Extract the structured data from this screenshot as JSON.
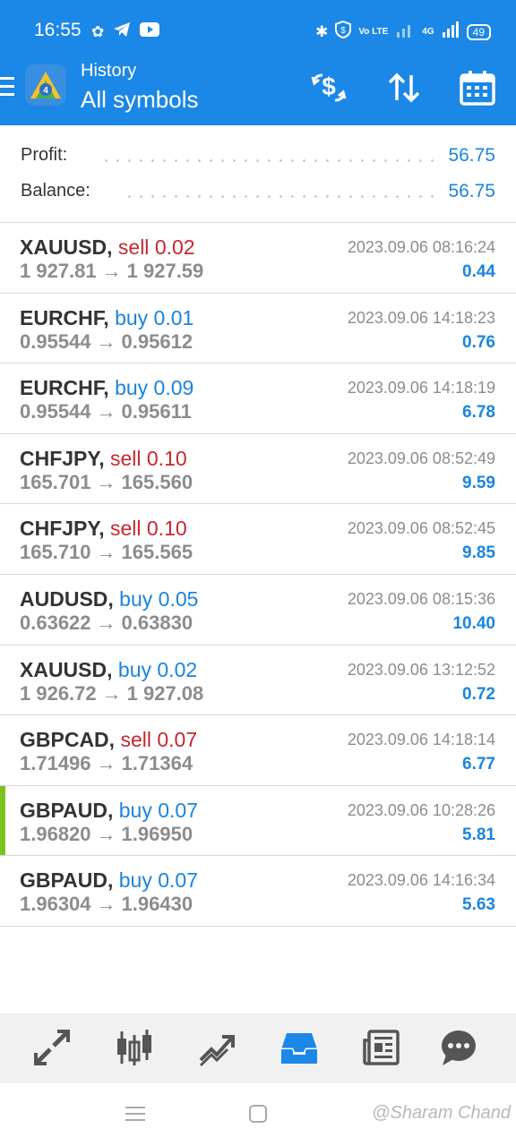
{
  "status_bar": {
    "time": "16:55",
    "left_icons": [
      "gear-icon",
      "telegram-icon",
      "youtube-icon"
    ],
    "right_icons": [
      "bluetooth-icon",
      "vpn-shield-icon",
      "volte-icon",
      "signal-icon",
      "4g-signal-icon"
    ],
    "volte_text": "Vo LTE",
    "network_text": "4G",
    "battery": "49"
  },
  "toolbar": {
    "subtitle": "History",
    "title": "All symbols",
    "icons": [
      "deposit-withdraw-icon",
      "sort-icon",
      "calendar-icon"
    ]
  },
  "summary": {
    "profit_label": "Profit:",
    "profit_value": "56.75",
    "balance_label": "Balance:",
    "balance_value": "56.75"
  },
  "deals": [
    {
      "symbol": "XAUUSD,",
      "side": "sell",
      "volume": "0.02",
      "open": "1 927.81",
      "close": "1 927.59",
      "time": "2023.09.06 08:16:24",
      "profit": "0.44",
      "selected": false
    },
    {
      "symbol": "EURCHF,",
      "side": "buy",
      "volume": "0.01",
      "open": "0.95544",
      "close": "0.95612",
      "time": "2023.09.06 14:18:23",
      "profit": "0.76",
      "selected": false
    },
    {
      "symbol": "EURCHF,",
      "side": "buy",
      "volume": "0.09",
      "open": "0.95544",
      "close": "0.95611",
      "time": "2023.09.06 14:18:19",
      "profit": "6.78",
      "selected": false
    },
    {
      "symbol": "CHFJPY,",
      "side": "sell",
      "volume": "0.10",
      "open": "165.701",
      "close": "165.560",
      "time": "2023.09.06 08:52:49",
      "profit": "9.59",
      "selected": false
    },
    {
      "symbol": "CHFJPY,",
      "side": "sell",
      "volume": "0.10",
      "open": "165.710",
      "close": "165.565",
      "time": "2023.09.06 08:52:45",
      "profit": "9.85",
      "selected": false
    },
    {
      "symbol": "AUDUSD,",
      "side": "buy",
      "volume": "0.05",
      "open": "0.63622",
      "close": "0.63830",
      "time": "2023.09.06 08:15:36",
      "profit": "10.40",
      "selected": false
    },
    {
      "symbol": "XAUUSD,",
      "side": "buy",
      "volume": "0.02",
      "open": "1 926.72",
      "close": "1 927.08",
      "time": "2023.09.06 13:12:52",
      "profit": "0.72",
      "selected": false
    },
    {
      "symbol": "GBPCAD,",
      "side": "sell",
      "volume": "0.07",
      "open": "1.71496",
      "close": "1.71364",
      "time": "2023.09.06 14:18:14",
      "profit": "6.77",
      "selected": false
    },
    {
      "symbol": "GBPAUD,",
      "side": "buy",
      "volume": "0.07",
      "open": "1.96820",
      "close": "1.96950",
      "time": "2023.09.06 10:28:26",
      "profit": "5.81",
      "selected": true
    },
    {
      "symbol": "GBPAUD,",
      "side": "buy",
      "volume": "0.07",
      "open": "1.96304",
      "close": "1.96430",
      "time": "2023.09.06 14:16:34",
      "profit": "5.63",
      "selected": false
    }
  ],
  "arrow_glyph": "→",
  "bottom_nav": {
    "items": [
      "quotes-icon",
      "chart-icon",
      "trade-icon",
      "history-icon",
      "news-icon",
      "chat-icon"
    ],
    "active": "history-icon",
    "active_color": "#1b87e6",
    "inactive_color": "#555555"
  },
  "watermark": "@Sharam Chand",
  "colors": {
    "header": "#1b87e6",
    "sell": "#c8262e",
    "buy": "#1a84de",
    "selected_marker": "#7cc21e"
  }
}
